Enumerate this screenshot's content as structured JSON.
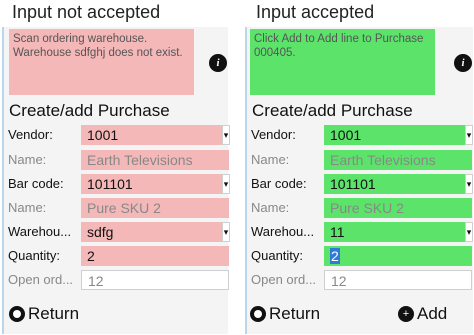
{
  "captions": {
    "left": "Input not accepted",
    "right": "Input accepted"
  },
  "left_panel": {
    "message": "Scan ordering warehouse. Warehouse sdfghj does not exist.",
    "heading": "Create/add Purchase",
    "fields": {
      "vendor_label": "Vendor:",
      "vendor_value": "1001",
      "name_label": "Name:",
      "name_value": "Earth Televisions",
      "barcode_label": "Bar code:",
      "barcode_value": "101101",
      "product_name_label": "Name:",
      "product_name_value": "Pure SKU 2",
      "warehouse_label": "Warehou...",
      "warehouse_value": "sdfg",
      "quantity_label": "Quantity:",
      "quantity_value": "2",
      "open_orders_label": "Open ord...",
      "open_orders_value": "12"
    },
    "return_label": "Return"
  },
  "right_panel": {
    "message": "Click Add to Add line to Purchase 000405.",
    "heading": "Create/add Purchase",
    "fields": {
      "vendor_label": "Vendor:",
      "vendor_value": "1001",
      "name_label": "Name:",
      "name_value": "Earth Televisions",
      "barcode_label": "Bar code:",
      "barcode_value": "101101",
      "product_name_label": "Name:",
      "product_name_value": "Pure SKU 2",
      "warehouse_label": "Warehou...",
      "warehouse_value": "11",
      "quantity_label": "Quantity:",
      "quantity_value": "2",
      "open_orders_label": "Open ord...",
      "open_orders_value": "12"
    },
    "return_label": "Return",
    "add_label": "Add"
  },
  "colors": {
    "error": "#f5b8b8",
    "accepted": "#5ce36a",
    "selection": "#2f7ad8"
  },
  "icons": [
    "info-icon",
    "return-icon",
    "add-icon",
    "dropdown-arrow-icon"
  ]
}
